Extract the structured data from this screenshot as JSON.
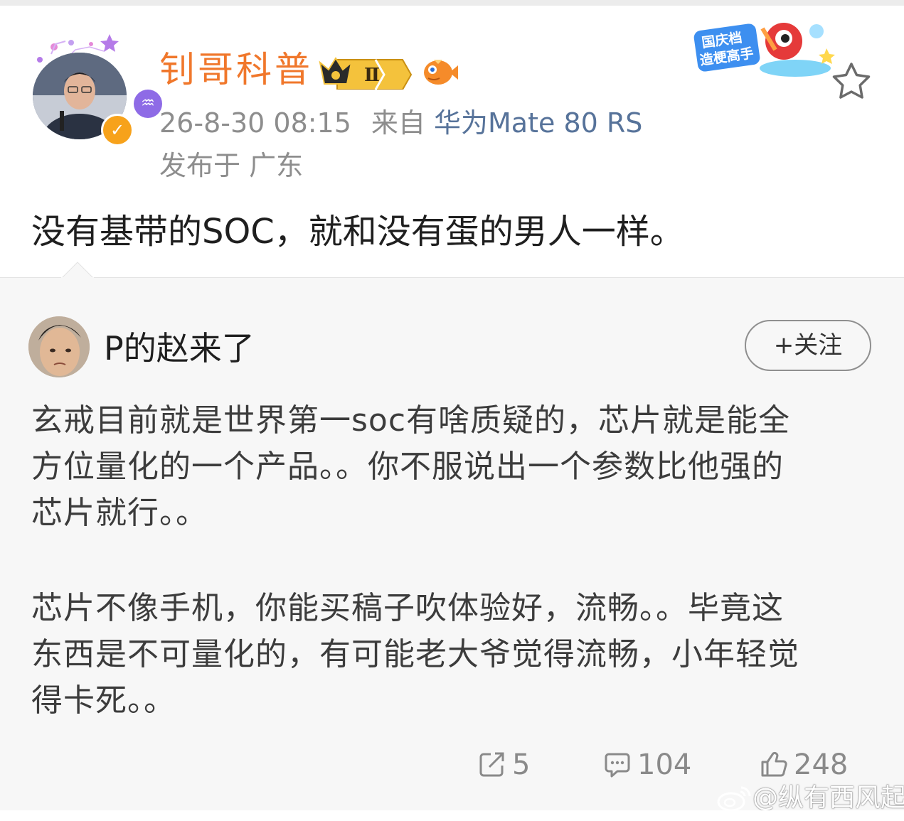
{
  "post": {
    "author": "钊哥科普",
    "level_badge": "Ⅱ",
    "timestamp": "26-8-30 08:15",
    "from_label": "来自",
    "source": "华为Mate 80 RS",
    "location": "发布于 广东",
    "text": "没有基带的SOC，就和没有蛋的男人一样。",
    "holiday_badge_line1": "国庆档",
    "holiday_badge_line2": "造梗高手"
  },
  "repost": {
    "author": "P的赵来了",
    "follow_label": "+关注",
    "paragraph1": [
      "玄戒目前就是世界第一soc有啥质疑的，芯片就是能全",
      "方位量化的一个产品。。你不服说出一个参数比他强的",
      "芯片就行。。"
    ],
    "paragraph2": [
      "芯片不像手机，你能买稿子吹体验好，流畅。。毕竟这",
      "东西是不可量化的，有可能老大爷觉得流畅，小年轻觉",
      "得卡死。。"
    ],
    "actions": {
      "repost_count": "5",
      "comment_count": "104",
      "like_count": "248"
    }
  },
  "watermark": "@纵有西风起",
  "colors": {
    "username": "#f0772b",
    "source_link": "#57739a",
    "meta": "#8d8d8d",
    "repost_bg": "#f7f7f7"
  },
  "icons": [
    "star-outline-icon",
    "verified-icon",
    "crown-badge-icon",
    "repost-icon",
    "comment-icon",
    "like-icon",
    "weibo-logo-icon"
  ]
}
